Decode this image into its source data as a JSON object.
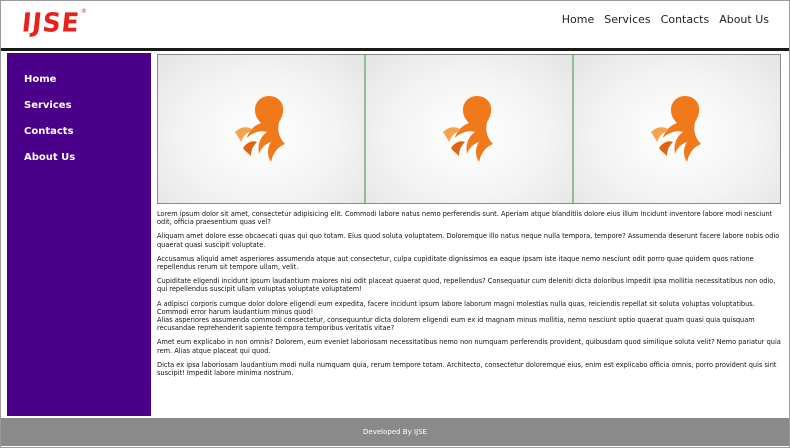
{
  "brand": {
    "logo_text": "IJSE",
    "registered_mark": "®",
    "logo_color": "#e8211c"
  },
  "top_nav": {
    "items": [
      "Home",
      "Services",
      "Contacts",
      "About Us"
    ]
  },
  "sidebar": {
    "items": [
      "Home",
      "Services",
      "Contacts",
      "About Us"
    ],
    "background": "#4a0089"
  },
  "gallery": {
    "images": [
      {
        "icon": "woman-silhouette-logo-icon"
      },
      {
        "icon": "woman-silhouette-logo-icon"
      },
      {
        "icon": "woman-silhouette-logo-icon"
      }
    ],
    "accent": "#f07a1a"
  },
  "article": {
    "paragraphs": [
      "Lorem ipsum dolor sit amet, consectetur adipisicing elit. Commodi labore natus nemo perferendis sunt. Aperiam atque blanditiis dolore eius illum incidunt inventore labore modi nesciunt odit, officia praesentium quas vel?",
      "Aliquam amet dolore esse obcaecati quas qui quo totam. Eius quod soluta voluptatem. Doloremque illo natus neque nulla tempora, tempore? Assumenda deserunt facere labore nobis odio quaerat quasi suscipit voluptate.",
      "Accusamus aliquid amet asperiores assumenda atque aut consectetur, culpa cupiditate dignissimos ea eaque ipsam iste itaque nemo nesciunt odit porro quae quidem quos ratione repellendus rerum sit tempore ullam, velit.",
      "Cupiditate eligendi incidunt ipsum laudantium maiores nisi odit placeat quaerat quod, repellendus? Consequatur cum deleniti dicta doloribus impedit ipsa mollitia necessitatibus non odio, qui repellendus suscipit ullam voluptas voluptate voluptatem!",
      "A adipisci corporis cumque dolor dolore eligendi eum expedita, facere incidunt ipsum labore laborum magni molestias nulla quas, reiciendis repellat sit soluta voluptas voluptatibus. Commodi error harum laudantium minus quod!",
      "Alias asperiores assumenda commodi consectetur, consequuntur dicta dolorem eligendi eum ex id magnam minus mollitia, nemo nesciunt optio quaerat quam quasi quia quisquam recusandae reprehenderit sapiente tempora temporibus veritatis vitae?",
      "Amet eum explicabo in non omnis? Dolorem, eum eveniet laboriosam necessitatibus nemo non numquam perferendis provident, quibusdam quod similique soluta velit? Nemo pariatur quia rem. Alias atque placeat qui quod.",
      "Dicta ex ipsa laboriosam laudantium modi nulla numquam quia, rerum tempore totam. Architecto, consectetur doloremque eius, enim est explicabo officia omnis, porro provident quis sint suscipit! Impedit labore minima nostrum."
    ]
  },
  "footer": {
    "text": "Developed By IJSE",
    "background": "#8a8a8a"
  }
}
